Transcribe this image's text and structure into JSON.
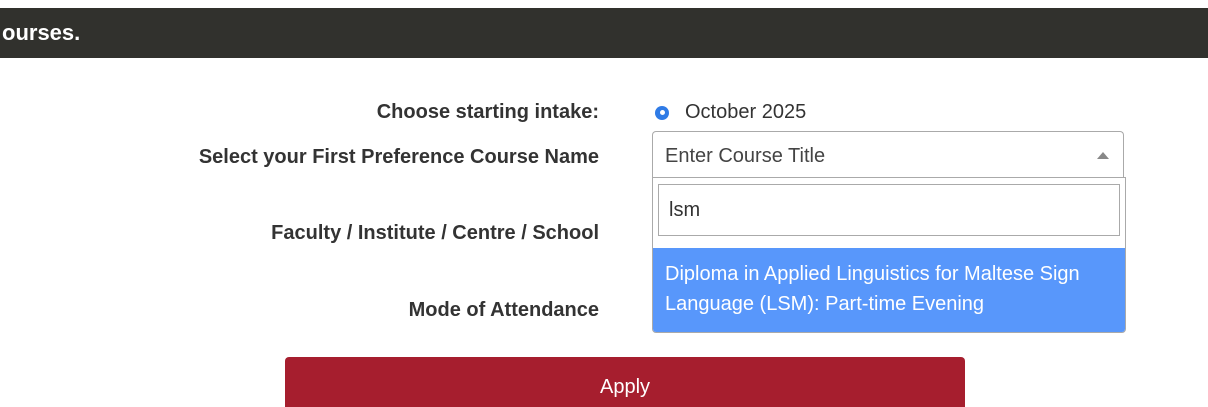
{
  "banner": {
    "text": "ourses."
  },
  "form": {
    "intake_label": "Choose starting intake:",
    "intake_option": "October 2025",
    "course_label": "Select your First Preference Course Name",
    "course_placeholder": "Enter Course Title",
    "faculty_label": "Faculty / Institute / Centre / School",
    "mode_label": "Mode of Attendance"
  },
  "dropdown": {
    "search_value": "lsm",
    "results": [
      "Diploma in Applied Linguistics for Maltese Sign Language (LSM): Part-time Evening"
    ]
  },
  "apply_button": {
    "label": "Apply"
  },
  "colors": {
    "banner": "#31312d",
    "radio": "#2f7be6",
    "highlight": "#5897fb",
    "apply": "#a61e2e"
  }
}
